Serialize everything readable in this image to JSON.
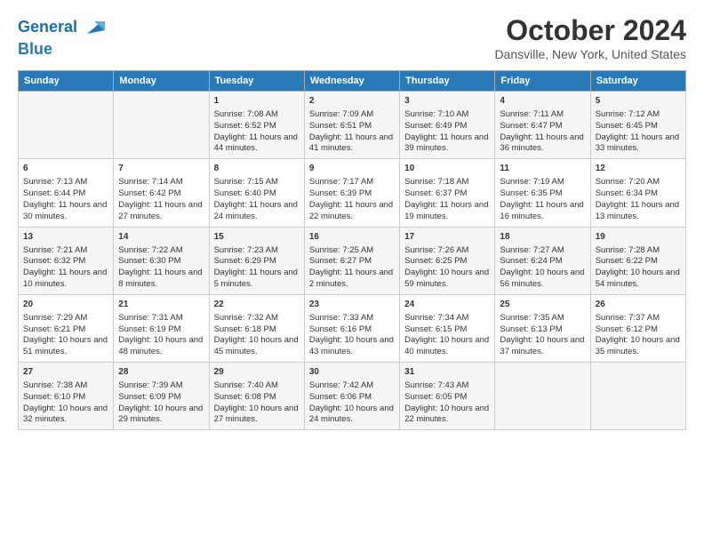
{
  "logo": {
    "line1": "General",
    "line2": "Blue"
  },
  "title": "October 2024",
  "subtitle": "Dansville, New York, United States",
  "days_of_week": [
    "Sunday",
    "Monday",
    "Tuesday",
    "Wednesday",
    "Thursday",
    "Friday",
    "Saturday"
  ],
  "weeks": [
    [
      {
        "day": "",
        "data": ""
      },
      {
        "day": "",
        "data": ""
      },
      {
        "day": "1",
        "data": "Sunrise: 7:08 AM\nSunset: 6:52 PM\nDaylight: 11 hours and 44 minutes."
      },
      {
        "day": "2",
        "data": "Sunrise: 7:09 AM\nSunset: 6:51 PM\nDaylight: 11 hours and 41 minutes."
      },
      {
        "day": "3",
        "data": "Sunrise: 7:10 AM\nSunset: 6:49 PM\nDaylight: 11 hours and 39 minutes."
      },
      {
        "day": "4",
        "data": "Sunrise: 7:11 AM\nSunset: 6:47 PM\nDaylight: 11 hours and 36 minutes."
      },
      {
        "day": "5",
        "data": "Sunrise: 7:12 AM\nSunset: 6:45 PM\nDaylight: 11 hours and 33 minutes."
      }
    ],
    [
      {
        "day": "6",
        "data": "Sunrise: 7:13 AM\nSunset: 6:44 PM\nDaylight: 11 hours and 30 minutes."
      },
      {
        "day": "7",
        "data": "Sunrise: 7:14 AM\nSunset: 6:42 PM\nDaylight: 11 hours and 27 minutes."
      },
      {
        "day": "8",
        "data": "Sunrise: 7:15 AM\nSunset: 6:40 PM\nDaylight: 11 hours and 24 minutes."
      },
      {
        "day": "9",
        "data": "Sunrise: 7:17 AM\nSunset: 6:39 PM\nDaylight: 11 hours and 22 minutes."
      },
      {
        "day": "10",
        "data": "Sunrise: 7:18 AM\nSunset: 6:37 PM\nDaylight: 11 hours and 19 minutes."
      },
      {
        "day": "11",
        "data": "Sunrise: 7:19 AM\nSunset: 6:35 PM\nDaylight: 11 hours and 16 minutes."
      },
      {
        "day": "12",
        "data": "Sunrise: 7:20 AM\nSunset: 6:34 PM\nDaylight: 11 hours and 13 minutes."
      }
    ],
    [
      {
        "day": "13",
        "data": "Sunrise: 7:21 AM\nSunset: 6:32 PM\nDaylight: 11 hours and 10 minutes."
      },
      {
        "day": "14",
        "data": "Sunrise: 7:22 AM\nSunset: 6:30 PM\nDaylight: 11 hours and 8 minutes."
      },
      {
        "day": "15",
        "data": "Sunrise: 7:23 AM\nSunset: 6:29 PM\nDaylight: 11 hours and 5 minutes."
      },
      {
        "day": "16",
        "data": "Sunrise: 7:25 AM\nSunset: 6:27 PM\nDaylight: 11 hours and 2 minutes."
      },
      {
        "day": "17",
        "data": "Sunrise: 7:26 AM\nSunset: 6:25 PM\nDaylight: 10 hours and 59 minutes."
      },
      {
        "day": "18",
        "data": "Sunrise: 7:27 AM\nSunset: 6:24 PM\nDaylight: 10 hours and 56 minutes."
      },
      {
        "day": "19",
        "data": "Sunrise: 7:28 AM\nSunset: 6:22 PM\nDaylight: 10 hours and 54 minutes."
      }
    ],
    [
      {
        "day": "20",
        "data": "Sunrise: 7:29 AM\nSunset: 6:21 PM\nDaylight: 10 hours and 51 minutes."
      },
      {
        "day": "21",
        "data": "Sunrise: 7:31 AM\nSunset: 6:19 PM\nDaylight: 10 hours and 48 minutes."
      },
      {
        "day": "22",
        "data": "Sunrise: 7:32 AM\nSunset: 6:18 PM\nDaylight: 10 hours and 45 minutes."
      },
      {
        "day": "23",
        "data": "Sunrise: 7:33 AM\nSunset: 6:16 PM\nDaylight: 10 hours and 43 minutes."
      },
      {
        "day": "24",
        "data": "Sunrise: 7:34 AM\nSunset: 6:15 PM\nDaylight: 10 hours and 40 minutes."
      },
      {
        "day": "25",
        "data": "Sunrise: 7:35 AM\nSunset: 6:13 PM\nDaylight: 10 hours and 37 minutes."
      },
      {
        "day": "26",
        "data": "Sunrise: 7:37 AM\nSunset: 6:12 PM\nDaylight: 10 hours and 35 minutes."
      }
    ],
    [
      {
        "day": "27",
        "data": "Sunrise: 7:38 AM\nSunset: 6:10 PM\nDaylight: 10 hours and 32 minutes."
      },
      {
        "day": "28",
        "data": "Sunrise: 7:39 AM\nSunset: 6:09 PM\nDaylight: 10 hours and 29 minutes."
      },
      {
        "day": "29",
        "data": "Sunrise: 7:40 AM\nSunset: 6:08 PM\nDaylight: 10 hours and 27 minutes."
      },
      {
        "day": "30",
        "data": "Sunrise: 7:42 AM\nSunset: 6:06 PM\nDaylight: 10 hours and 24 minutes."
      },
      {
        "day": "31",
        "data": "Sunrise: 7:43 AM\nSunset: 6:05 PM\nDaylight: 10 hours and 22 minutes."
      },
      {
        "day": "",
        "data": ""
      },
      {
        "day": "",
        "data": ""
      }
    ]
  ]
}
